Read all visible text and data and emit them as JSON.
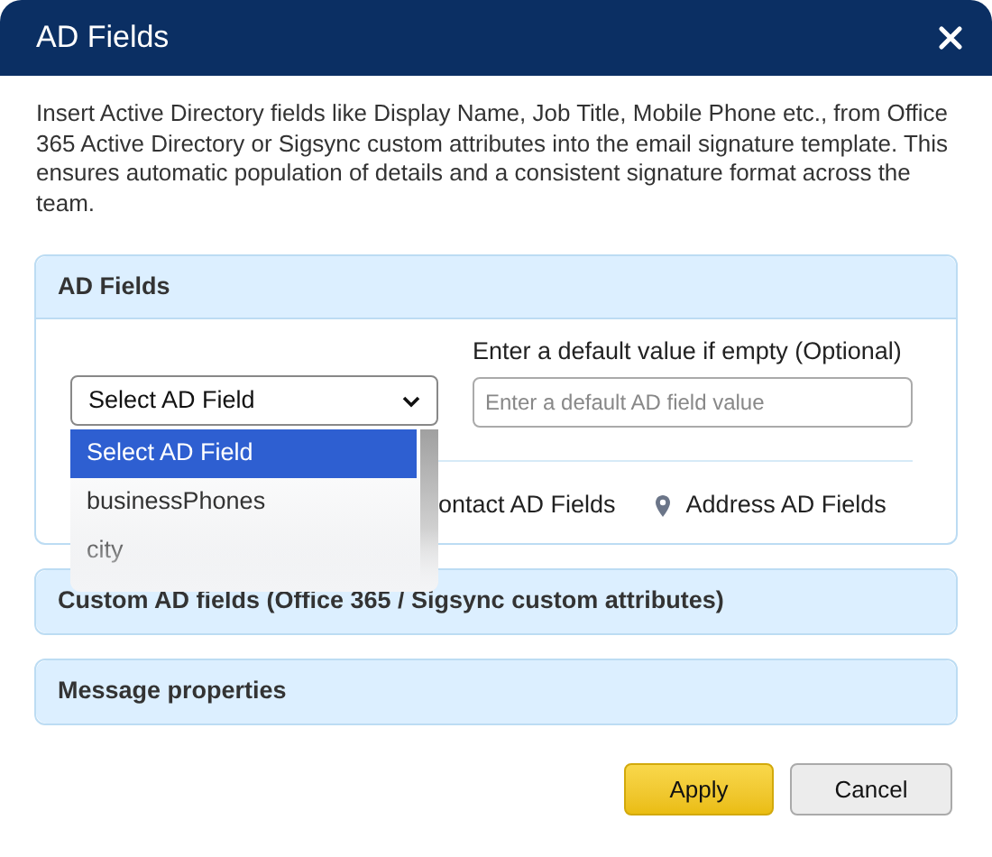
{
  "dialog": {
    "title": "AD Fields"
  },
  "description": "Insert Active Directory fields like Display Name, Job Title, Mobile Phone etc., from Office 365 Active Directory or Sigsync custom attributes into the email signature template. This ensures automatic population of details and a consistent signature format across the team.",
  "sections": [
    {
      "title": "AD Fields",
      "expanded": true
    },
    {
      "title": "Custom AD fields (Office 365 / Sigsync custom attributes)",
      "expanded": false
    },
    {
      "title": "Message properties",
      "expanded": false
    }
  ],
  "ad_fields": {
    "select": {
      "value": "Select AD Field",
      "open": true,
      "options": [
        {
          "label": "Select AD Field",
          "selected": true
        },
        {
          "label": "businessPhones",
          "selected": false
        },
        {
          "label": "city",
          "selected": false
        }
      ]
    },
    "default_label": "Enter a default value if empty (Optional)",
    "default_input": {
      "placeholder": "Enter a default AD field value"
    },
    "tabs": [
      {
        "label": "ontact AD Fields",
        "kind": "contact"
      },
      {
        "label": "Address AD Fields",
        "kind": "address"
      }
    ]
  },
  "buttons": [
    {
      "label": "Apply",
      "kind": "primary"
    },
    {
      "label": "Cancel",
      "kind": "secondary"
    }
  ]
}
